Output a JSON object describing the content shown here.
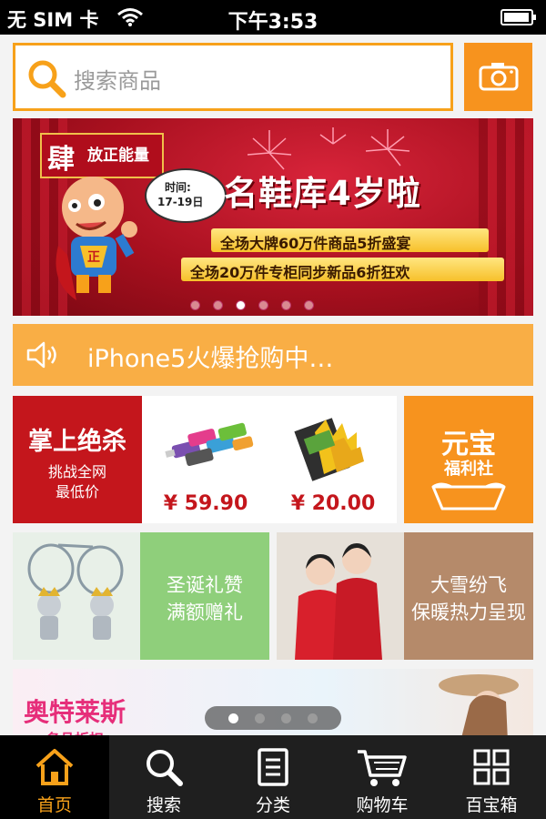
{
  "status_bar": {
    "carrier": "无 SIM 卡",
    "time": "下午3:53"
  },
  "search": {
    "placeholder": "搜索商品"
  },
  "banner": {
    "tag": "放正能量",
    "tag_char": "肆",
    "date_label": "时间:",
    "date_value": "17-19日",
    "headline": "名鞋库4岁啦",
    "promo_line_1": "全场大牌60万件商品5折盛宴",
    "promo_line_2": "全场20万件专柜同步新品6折狂欢",
    "page_count": 6,
    "active_page": 3
  },
  "notice": {
    "text": "iPhone5火爆抢购中…"
  },
  "deals": {
    "red_title": "掌上绝杀",
    "red_sub1": "挑战全网",
    "red_sub2": "最低价",
    "item1_price": "¥ 59.90",
    "item2_price": "¥ 20.00",
    "orange_title": "元宝",
    "orange_sub": "福利社"
  },
  "tiles": {
    "left_line1": "圣诞礼赞",
    "left_line2": "满额赠礼",
    "right_line1": "大雪纷飞",
    "right_line2": "保暖热力呈现"
  },
  "bottom_banner": {
    "title": "奥特莱斯",
    "subtitle": "名品折扣",
    "page_count": 4,
    "active_page": 1
  },
  "tab_bar": {
    "tabs": [
      {
        "label": "首页",
        "icon": "home-icon",
        "active": true
      },
      {
        "label": "搜索",
        "icon": "search-icon",
        "active": false
      },
      {
        "label": "分类",
        "icon": "list-icon",
        "active": false
      },
      {
        "label": "购物车",
        "icon": "cart-icon",
        "active": false
      },
      {
        "label": "百宝箱",
        "icon": "grid-icon",
        "active": false
      }
    ]
  },
  "colors": {
    "accent_orange": "#f7931e",
    "deal_red": "#c4161c",
    "tabbar_bg": "#1f1f1f"
  }
}
